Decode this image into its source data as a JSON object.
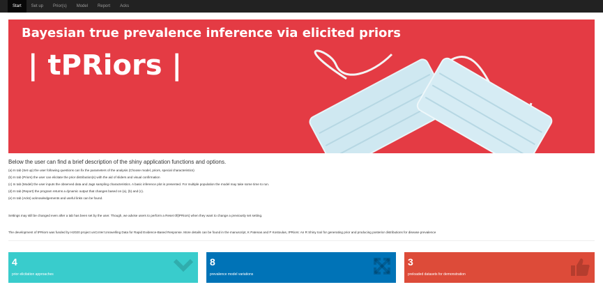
{
  "nav": {
    "tabs": [
      {
        "label": "Start",
        "active": true
      },
      {
        "label": "Set up",
        "active": false
      },
      {
        "label": "Prior(s)",
        "active": false
      },
      {
        "label": "Model",
        "active": false
      },
      {
        "label": "Report",
        "active": false
      },
      {
        "label": "Acks",
        "active": false
      }
    ]
  },
  "banner": {
    "title": "Bayesian true prevalence inference via elicited priors",
    "logo": "| tPRiors |",
    "background_color": "#e43b44"
  },
  "intro": {
    "heading": "Below the user can find a brief description of the shiny application functions and options.",
    "lines": [
      "(a) In tab (Set up) the user following questions can fix the parameters of the analysis (Choose model, priors, special characteristics)",
      "(b) In tab (Priors) the user can elicitate the prior distribution(s) with the aid of sliders and visual confirmation",
      "(c) In tab (Model) the user inputs the observed data and Jags sampling characteristics. A basic inference plot is presented. For multiple population the model may take some time to run.",
      "(d) In tab (Report) the program returns a dynamic output that changes based on (a), (b) and (c).",
      "(e) In tab (Acks) acknowledgements and useful links can be found."
    ],
    "note": "Settings may still be changed even after a tab has been set by the user. Though, we advise users to perform a Reset 0f(tPRiors) when they want to change a previously set setting.",
    "funding": "The development of tPRiors was funded by H2020 project unCoVer:Unravelling Data for Rapid Evidence-Based Response. More details can be found in the manuscript, K Patenas and P Kostoulas, tPRiors: An R Shiny tool for generating prior and producing posterior distributions for disease prevalence"
  },
  "value_boxes": [
    {
      "value": "4",
      "subtitle": "prior elicitation approaches",
      "color": "#39cccc",
      "icon": "chevron-down-icon"
    },
    {
      "value": "8",
      "subtitle": "prevalence model variations",
      "color": "#0073b7",
      "icon": "expand-arrows-icon"
    },
    {
      "value": "3",
      "subtitle": "preloaded datasets for demonstration",
      "color": "#dd4b39",
      "icon": "thumbs-up-icon"
    }
  ]
}
